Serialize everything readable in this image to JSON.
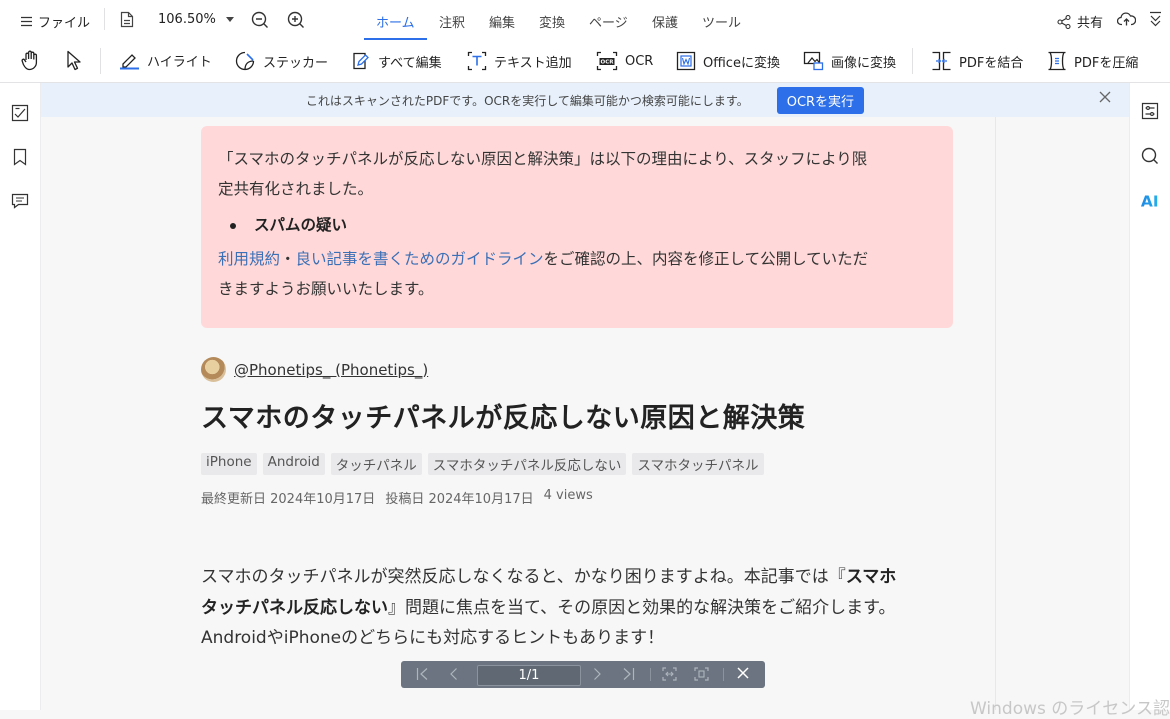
{
  "topbar": {
    "menu_label": "ファイル",
    "zoom": "106.50%",
    "tabs": [
      "ホーム",
      "注釈",
      "編集",
      "変換",
      "ページ",
      "保護",
      "ツール"
    ],
    "active_tab": "ホーム",
    "share_label": "共有"
  },
  "toolbar": {
    "highlight": "ハイライト",
    "sticker": "ステッカー",
    "edit_all": "すべて編集",
    "add_text": "テキスト追加",
    "ocr": "OCR",
    "to_office": "Officeに変換",
    "to_image": "画像に変換",
    "merge_pdf": "PDFを結合",
    "compress_pdf": "PDFを圧縮"
  },
  "banner": {
    "message": "これはスキャンされたPDFです。OCRを実行して編集可能かつ検索可能にします。",
    "button": "OCRを実行"
  },
  "document": {
    "notice_line1": "「スマホのタッチパネルが反応しない原因と解決策」は以下の理由により、スタッフにより限",
    "notice_line2": "定共有化されました。",
    "notice_reason": "スパムの疑い",
    "notice_link1": "利用規約",
    "notice_dot": "・",
    "notice_link2": "良い記事を書くためのガイドライン",
    "notice_line3_rest": "をご確認の上、内容を修正して公開していただ",
    "notice_line4": "きますようお願いいたします。",
    "author": "@Phonetips_ (Phonetips_)",
    "title": "スマホのタッチパネルが反応しない原因と解決策",
    "tags": [
      "iPhone",
      "Android",
      "タッチパネル",
      "スマホタッチパネル反応しない",
      "スマホタッチパネル"
    ],
    "updated": "最終更新日 2024年10月17日",
    "posted": "投稿日 2024年10月17日",
    "views": "4 views",
    "body_l1_a": "スマホのタッチパネルが突然反応しなくなると、かなり困りますよね。本記事では『",
    "body_l1_b": "スマホ",
    "body_l2_b": "タッチパネル反応しない",
    "body_l2_a": "』問題に焦点を当て、その原因と効果的な解決策をご紹介します。",
    "body_l3": "AndroidやiPhoneのどちらにも対応するヒントもあります！"
  },
  "pager": {
    "page": "1/1"
  },
  "watermark": "Windows のライセンス認証"
}
